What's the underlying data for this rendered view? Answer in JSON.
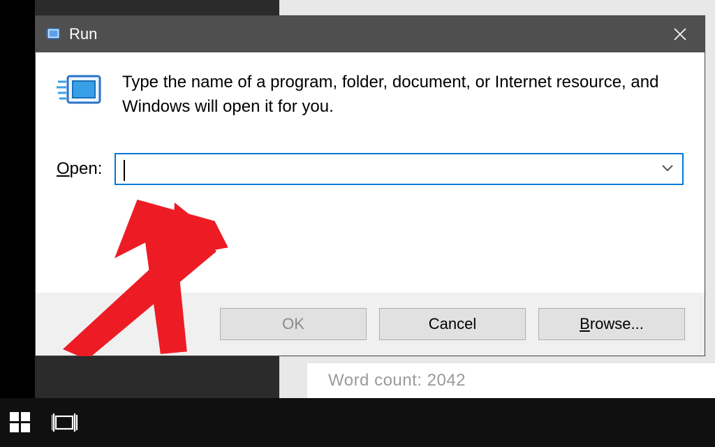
{
  "titlebar": {
    "title": "Run"
  },
  "instructions": "Type the name of a program, folder, document, or Internet resource, and Windows will open it for you.",
  "open_label_prefix": "O",
  "open_label_rest": "pen:",
  "input_value": "",
  "buttons": {
    "ok": "OK",
    "cancel": "Cancel",
    "browse_prefix": "B",
    "browse_rest": "rowse..."
  },
  "background_hint": "Word count: 2042"
}
